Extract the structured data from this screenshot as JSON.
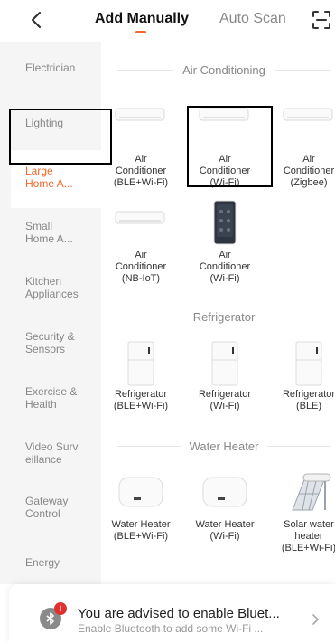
{
  "header": {
    "tab_manual": "Add Manually",
    "tab_auto": "Auto Scan"
  },
  "sidebar": {
    "items": [
      {
        "label": "Electrician"
      },
      {
        "label": "Lighting"
      },
      {
        "label": "Large\nHome A..."
      },
      {
        "label": "Small\nHome A..."
      },
      {
        "label": "Kitchen\nAppliances"
      },
      {
        "label": "Security &\nSensors"
      },
      {
        "label": "Exercise &\nHealth"
      },
      {
        "label": "Video Surv\neillance"
      },
      {
        "label": "Gateway\nControl"
      },
      {
        "label": "Energy"
      }
    ],
    "active_index": 2
  },
  "sections": [
    {
      "title": "Air Conditioning",
      "devices": [
        {
          "label": "Air\nConditioner\n(BLE+Wi-Fi)",
          "icon": "air-conditioner-icon"
        },
        {
          "label": "Air\nConditioner\n(Wi-Fi)",
          "icon": "air-conditioner-icon"
        },
        {
          "label": "Air\nConditioner\n(Zigbee)",
          "icon": "air-conditioner-icon"
        },
        {
          "label": "Air\nConditioner\n(NB-IoT)",
          "icon": "air-conditioner-icon"
        },
        {
          "label": "Air\nConditioner\n(Wi-Fi)",
          "icon": "ac-remote-panel-icon"
        }
      ]
    },
    {
      "title": "Refrigerator",
      "devices": [
        {
          "label": "Refrigerator\n(BLE+Wi-Fi)",
          "icon": "refrigerator-icon"
        },
        {
          "label": "Refrigerator\n(Wi-Fi)",
          "icon": "refrigerator-icon"
        },
        {
          "label": "Refrigerator\n(BLE)",
          "icon": "refrigerator-icon"
        }
      ]
    },
    {
      "title": "Water Heater",
      "devices": [
        {
          "label": "Water Heater\n(BLE+Wi-Fi)",
          "icon": "water-heater-icon"
        },
        {
          "label": "Water Heater\n(Wi-Fi)",
          "icon": "water-heater-icon"
        },
        {
          "label": "Solar water\nheater\n(BLE+Wi-Fi)",
          "icon": "solar-water-heater-icon"
        }
      ]
    }
  ],
  "bluetooth_banner": {
    "title": "You are advised to enable Bluet...",
    "subtitle": "Enable Bluetooth to add some Wi-Fi ...",
    "badge": "!"
  },
  "colors": {
    "accent": "#f0692a",
    "sidebar_bg": "#f5f5f5",
    "badge": "#e03131"
  }
}
